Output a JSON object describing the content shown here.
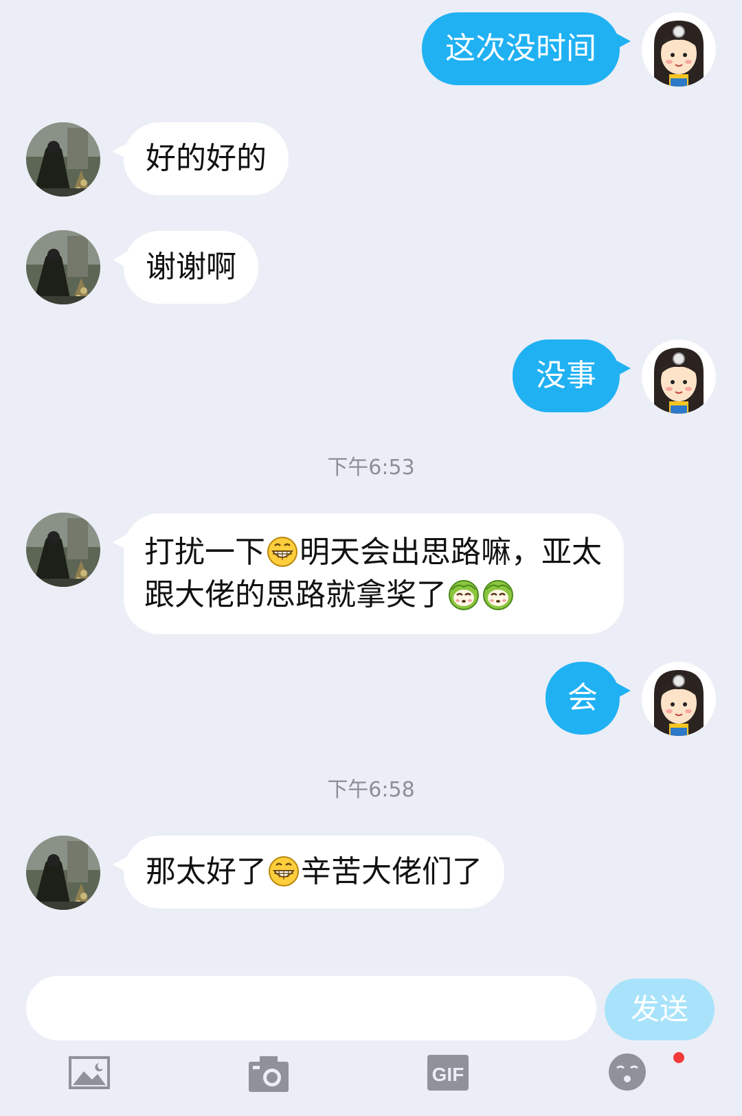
{
  "colors": {
    "background": "#ebeef6",
    "outgoing_bubble": "#20b1f3",
    "incoming_bubble": "#ffffff",
    "send_button": "#a8e3fb",
    "notification_dot": "#f33a3a"
  },
  "messages": [
    {
      "side": "out",
      "text": "这次没时间"
    },
    {
      "side": "in",
      "text": "好的好的"
    },
    {
      "side": "in",
      "text": "谢谢啊"
    },
    {
      "side": "out",
      "text": "没事"
    },
    {
      "time": "下午6:53"
    },
    {
      "side": "in",
      "parts": [
        "打扰一下",
        "grin-emoji",
        "明天会出思路嘛，亚太跟大佬的思路就拿奖了",
        "cabbage-emoji",
        "cabbage-emoji"
      ]
    },
    {
      "side": "out",
      "text": "会"
    },
    {
      "time": "下午6:58"
    },
    {
      "side": "in",
      "parts": [
        "那太好了",
        "grin-emoji",
        "辛苦大佬们了"
      ]
    }
  ],
  "msg": {
    "m1": "这次没时间",
    "m2": "好的好的",
    "m3": "谢谢啊",
    "m4": "没事",
    "t1": "下午6:53",
    "m5a": "打扰一下",
    "m5b": "明天会出思路嘛，亚太跟大佬的思路就拿奖了",
    "m6": "会",
    "t2": "下午6:58",
    "m7a": "那太好了",
    "m7b": "辛苦大佬们了"
  },
  "input": {
    "placeholder": "",
    "send_label": "发送"
  },
  "toolbar": {
    "items": [
      "image-icon",
      "camera-icon",
      "gif-icon",
      "emoji-icon"
    ],
    "gif_label": "GIF",
    "emoji_badge": true
  }
}
